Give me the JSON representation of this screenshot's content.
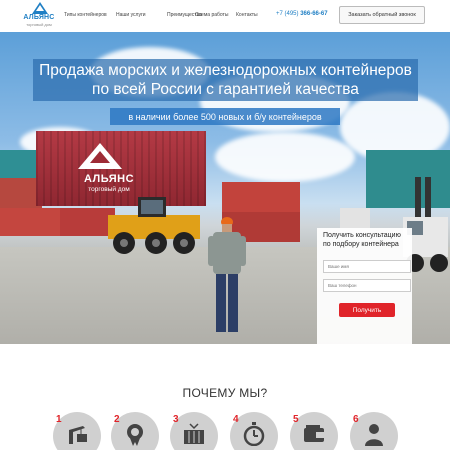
{
  "header": {
    "logo_name": "АЛЬЯНС",
    "logo_sub": "торговый дом",
    "nav": [
      "Типы контейнеров",
      "Наши услуги",
      "Преимущества",
      "Схема работы",
      "Контакты"
    ],
    "phone_prefix": "+7 (495)",
    "phone_number": "366-66-67",
    "callback_label": "Заказать обратный звонок"
  },
  "hero": {
    "title_line1": "Продажа морских и железнодорожных контейнеров",
    "title_line2": "по всей России с гарантией качества",
    "subtitle": "в наличии более 500 новых и б/у контейнеров",
    "container_brand": "АЛЬЯНС",
    "container_sub": "торговый дом"
  },
  "form": {
    "title_line1": "Получить консультацию",
    "title_line2": "по подбору контейнера",
    "name_placeholder": "Ваше имя",
    "phone_placeholder": "Ваш телефон",
    "submit_label": "Получить"
  },
  "why": {
    "title": "ПОЧЕМУ МЫ?",
    "features": [
      {
        "num": "1",
        "icon": "crane-icon"
      },
      {
        "num": "2",
        "icon": "award-icon"
      },
      {
        "num": "3",
        "icon": "container-lift-icon"
      },
      {
        "num": "4",
        "icon": "stopwatch-icon"
      },
      {
        "num": "5",
        "icon": "wallet-icon"
      },
      {
        "num": "6",
        "icon": "person-icon"
      }
    ]
  },
  "colors": {
    "brand_blue": "#1f7fc4",
    "accent_red": "#e0242a",
    "feature_circle": "#d0d0d0"
  }
}
